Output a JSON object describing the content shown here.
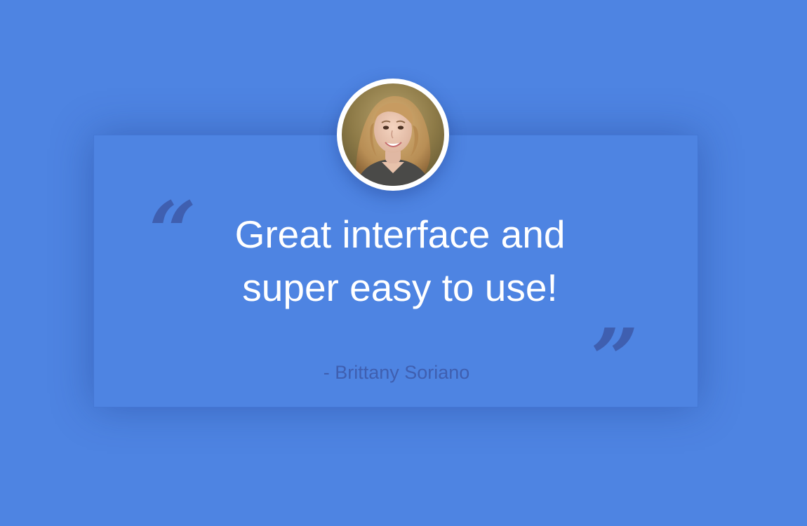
{
  "testimonial": {
    "quote_line_1": "Great interface and",
    "quote_line_2": "super easy to use!",
    "author": "- Brittany Soriano",
    "open_quote": "“",
    "close_quote": "”"
  },
  "icons": {
    "open_quote": "left-double-quote-icon",
    "close_quote": "right-double-quote-icon",
    "avatar": "avatar"
  },
  "colors": {
    "background": "#4e84e2",
    "text": "#ffffff",
    "accent": "#3f5fb0",
    "avatar_border": "#ffffff"
  }
}
